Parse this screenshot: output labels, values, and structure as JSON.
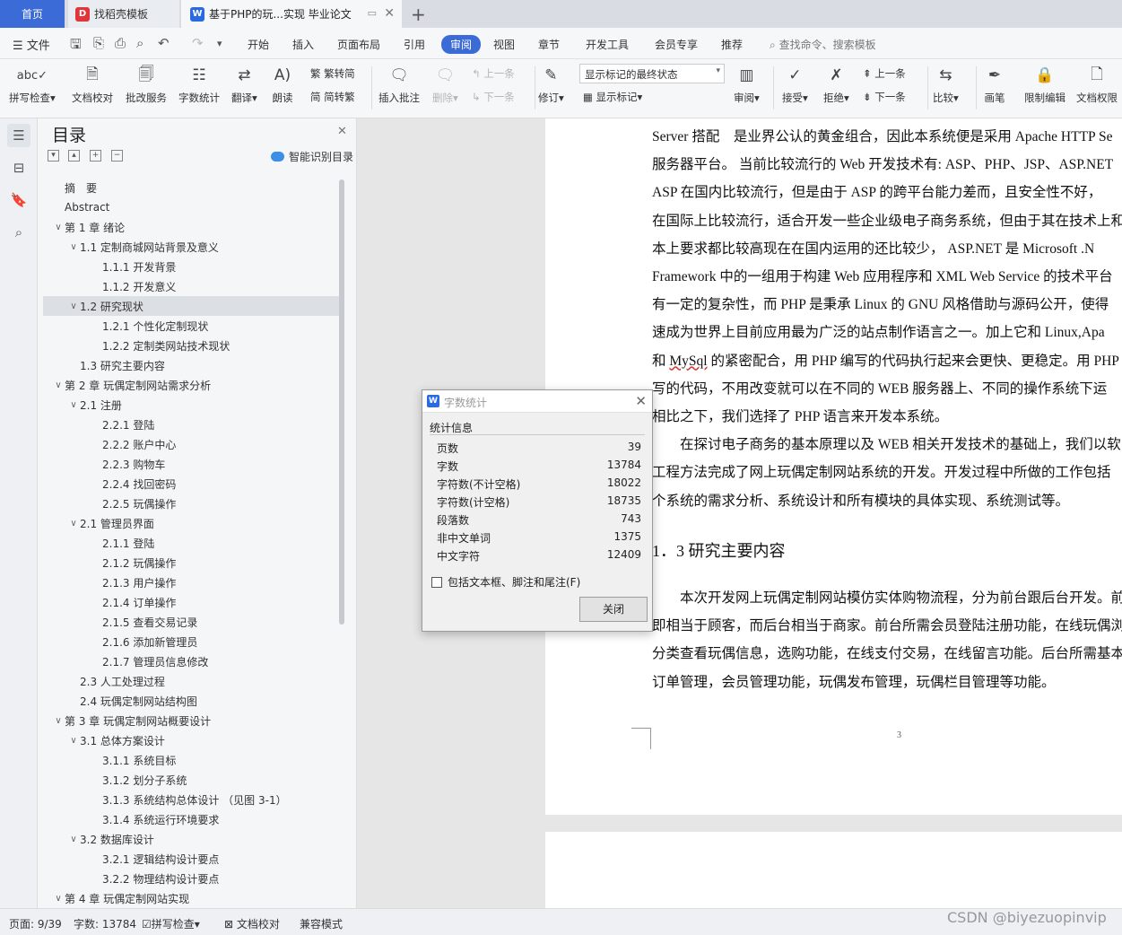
{
  "tabs": {
    "home": "首页",
    "templates": "找稻壳模板",
    "document": "基于PHP的玩...实现 毕业论文",
    "templates_logo": "D",
    "doc_logo": "W"
  },
  "menu": {
    "file": "文件",
    "items": [
      "开始",
      "插入",
      "页面布局",
      "引用",
      "审阅",
      "视图",
      "章节",
      "开发工具",
      "会员专享",
      "推荐"
    ],
    "active": "审阅",
    "search": "查找命令、搜索模板"
  },
  "ribbon": {
    "spell_check": "拼写检查",
    "doc_proof": "文档校对",
    "batch_service": "批改服务",
    "word_count": "字数统计",
    "translate": "翻译",
    "read_aloud": "朗读",
    "trad_chinese": "繁转简",
    "simp_chinese": "简转繁",
    "insert_comment": "插入批注",
    "delete": "删除",
    "prev_comment": "上一条",
    "next_comment": "下一条",
    "revise": "修订",
    "markup_state": "显示标记的最终状态",
    "show_markup": "显示标记",
    "review": "审阅",
    "accept": "接受",
    "reject": "拒绝",
    "prev_change": "上一条",
    "next_change": "下一条",
    "compare": "比较",
    "draw": "画笔",
    "restrict_edit": "限制编辑",
    "doc_permission": "文档权限"
  },
  "toc": {
    "title": "目录",
    "smart": "智能识别目录",
    "items": [
      {
        "text": "摘　要",
        "level": 0,
        "chev": ""
      },
      {
        "text": "Abstract",
        "level": 0,
        "chev": ""
      },
      {
        "text": "第 1 章  绪论",
        "level": 0,
        "chev": "v"
      },
      {
        "text": "1.1  定制商城网站背景及意义",
        "level": 1,
        "chev": "v"
      },
      {
        "text": "1.1.1  开发背景",
        "level": 2,
        "chev": ""
      },
      {
        "text": "1.1.2  开发意义",
        "level": 2,
        "chev": ""
      },
      {
        "text": "1.2 研究现状",
        "level": 1,
        "chev": "v",
        "selected": true
      },
      {
        "text": "1.2.1 个性化定制现状",
        "level": 2,
        "chev": ""
      },
      {
        "text": "1.2.2  定制类网站技术现状",
        "level": 2,
        "chev": ""
      },
      {
        "text": "1.3  研究主要内容",
        "level": 1,
        "chev": ""
      },
      {
        "text": "第 2 章  玩偶定制网站需求分析",
        "level": 0,
        "chev": "v"
      },
      {
        "text": "2.1 注册",
        "level": 1,
        "chev": "v"
      },
      {
        "text": "2.2.1 登陆",
        "level": 2,
        "chev": ""
      },
      {
        "text": "2.2.2 账户中心",
        "level": 2,
        "chev": ""
      },
      {
        "text": "2.2.3 购物车",
        "level": 2,
        "chev": ""
      },
      {
        "text": "2.2.4 找回密码",
        "level": 2,
        "chev": ""
      },
      {
        "text": "2.2.5 玩偶操作",
        "level": 2,
        "chev": ""
      },
      {
        "text": "2.1 管理员界面",
        "level": 1,
        "chev": "v"
      },
      {
        "text": "2.1.1 登陆",
        "level": 2,
        "chev": ""
      },
      {
        "text": "2.1.2 玩偶操作",
        "level": 2,
        "chev": ""
      },
      {
        "text": "2.1.3 用户操作",
        "level": 2,
        "chev": ""
      },
      {
        "text": "2.1.4 订单操作",
        "level": 2,
        "chev": ""
      },
      {
        "text": "2.1.5 查看交易记录",
        "level": 2,
        "chev": ""
      },
      {
        "text": "2.1.6 添加新管理员",
        "level": 2,
        "chev": ""
      },
      {
        "text": "2.1.7 管理员信息修改",
        "level": 2,
        "chev": ""
      },
      {
        "text": "2.3 人工处理过程",
        "level": 1,
        "chev": ""
      },
      {
        "text": "2.4 玩偶定制网站结构图",
        "level": 1,
        "chev": ""
      },
      {
        "text": "第 3 章  玩偶定制网站概要设计",
        "level": 0,
        "chev": "v"
      },
      {
        "text": "3.1 总体方案设计",
        "level": 1,
        "chev": "v"
      },
      {
        "text": "3.1.1  系统目标",
        "level": 2,
        "chev": ""
      },
      {
        "text": "3.1.2  划分子系统",
        "level": 2,
        "chev": ""
      },
      {
        "text": "3.1.3  系统结构总体设计  （见图 3-1）",
        "level": 2,
        "chev": ""
      },
      {
        "text": "3.1.4  系统运行环境要求",
        "level": 2,
        "chev": ""
      },
      {
        "text": "3.2  数据库设计",
        "level": 1,
        "chev": "v"
      },
      {
        "text": "3.2.1 逻辑结构设计要点",
        "level": 2,
        "chev": ""
      },
      {
        "text": "3.2.2 物理结构设计要点",
        "level": 2,
        "chev": ""
      },
      {
        "text": "第 4 章  玩偶定制网站实现",
        "level": 0,
        "chev": "v"
      }
    ]
  },
  "document": {
    "lines": [
      "Server 搭配　是业界公认的黄金组合，因此本系统便是采用 Apache HTTP Se",
      "服务器平台。 当前比较流行的 Web 开发技术有: ASP、PHP、JSP、ASP.NET",
      "ASP 在国内比较流行，但是由于 ASP 的跨平台能力差而，且安全性不好，",
      "在国际上比较流行，适合开发一些企业级电子商务系统，但由于其在技术上和",
      "本上要求都比较高现在在国内运用的还比较少， ASP.NET 是 Microsoft .N",
      "Framework 中的一组用于构建 Web 应用程序和 XML Web Service 的技术平台",
      "有一定的复杂性，而 PHP 是秉承 Linux 的 GNU 风格借助与源码公开，使得",
      "速成为世界上目前应用最为广泛的站点制作语言之一。加上它和 Linux,Apa",
      "和 MySql 的紧密配合，用 PHP 编写的代码执行起来会更快、更稳定。用 PHP",
      "写的代码，不用改变就可以在不同的 WEB 服务器上、不同的操作系统下运",
      "相比之下，我们选择了 PHP 语言来开发本系统。",
      "　　在探讨电子商务的基本原理以及 WEB 相关开发技术的基础上，我们以软",
      "工程方法完成了网上玩偶定制网站系统的开发。开发过程中所做的工作包括",
      "个系统的需求分析、系统设计和所有模块的具体实现、系统测试等。"
    ],
    "heading": "1．3  研究主要内容",
    "lines2": [
      "　　本次开发网上玩偶定制网站模仿实体购物流程，分为前台跟后台开发。前",
      "即相当于顾客，而后台相当于商家。前台所需会员登陆注册功能，在线玩偶浏",
      "分类查看玩偶信息，选购功能，在线支付交易，在线留言功能。后台所需基本",
      "订单管理，会员管理功能，玩偶发布管理，玩偶栏目管理等功能。"
    ],
    "page_number": "3"
  },
  "dialog": {
    "title": "字数统计",
    "logo": "W",
    "group": "统计信息",
    "stats": [
      {
        "label": "页数",
        "value": "39"
      },
      {
        "label": "字数",
        "value": "13784"
      },
      {
        "label": "字符数(不计空格)",
        "value": "18022"
      },
      {
        "label": "字符数(计空格)",
        "value": "18735"
      },
      {
        "label": "段落数",
        "value": "743"
      },
      {
        "label": "非中文单词",
        "value": "1375"
      },
      {
        "label": "中文字符",
        "value": "12409"
      }
    ],
    "checkbox": "包括文本框、脚注和尾注(F)",
    "checkbox_checked": false,
    "close": "关闭"
  },
  "status": {
    "page": "页面: 9/39",
    "words": "字数: 13784",
    "spell": "拼写检查",
    "proof": "文档校对",
    "compat": "兼容模式"
  },
  "watermark": "CSDN @biyezuopinvip",
  "colors": {
    "accent": "#3b6bd6",
    "home_tab": "#3b6bd6",
    "wps_red": "#e0353b",
    "wps_blue": "#2a6ae0"
  }
}
